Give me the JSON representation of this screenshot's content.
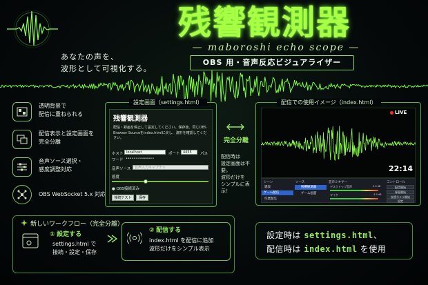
{
  "title": "残響観測器",
  "subtitle": "— maboroshi echo scope —",
  "badge": "OBS 用・音声反応ビジュアライザー",
  "tagline": [
    "あなたの声を、",
    "波形として可視化する。"
  ],
  "features": [
    {
      "icon": "transparent-window-icon",
      "text": "透明背景で\n配信に重ねられる"
    },
    {
      "icon": "dual-screen-icon",
      "text": "配信表示と設定画面を\n完全分離"
    },
    {
      "icon": "sliders-icon",
      "text": "音声ソース選択・\n感度調整対応"
    },
    {
      "icon": "network-icon",
      "text": "OBS WebSocket 5.x 対応"
    }
  ],
  "settings_panel": {
    "tag": "設定画面（settings.html）",
    "heading": "残響観測器",
    "note": "配信・録画を停止して設定してください。保存後、同じOBS Browser Sourceをindex.htmlに戻し、波形を確認してください。",
    "host_label": "ホスト",
    "host_value": "localhost",
    "port_label": "ポート",
    "port_value": "4455",
    "password_label": "パス",
    "password_label2": "ワード",
    "password_value": "••••••••••••••",
    "audio_label": "音声ソース",
    "audio_placeholder": "音声入力キャプチャ",
    "sensitivity_label": "感度",
    "sensitivity_level": 0.35,
    "status": "● OBS接続済み",
    "test_button": "接続テスト",
    "save_button": "保存"
  },
  "separator": {
    "label": "完全分離",
    "note": [
      "配信時は",
      "設定画面は不要。",
      "波形だけを",
      "シンプルに表示！"
    ]
  },
  "live_panel": {
    "tag": "配信での使用イメージ（index.html）",
    "live": "LIVE",
    "time": "22:14",
    "obs": {
      "scenes_header": "シーン",
      "scenes": [
        "雑談",
        "ゲーム配信",
        "作業配信"
      ],
      "sources_header": "ソース",
      "sources": [
        "残響観測器",
        "ゲーム画面"
      ],
      "mixer_header": "音声ミキサー",
      "mixer": [
        "デスクトップ音声",
        "マイク"
      ],
      "mixer_db": [
        "0.0 dB",
        "-3.0 dB"
      ],
      "controls_header": "コントロール",
      "controls": [
        "配信開始",
        "録画開始",
        "仮想カメラ開始",
        "設定"
      ]
    }
  },
  "workflow": {
    "title": "新しいワークフロー（完全分離）",
    "step1_num": "①",
    "step1_title": "設定する",
    "step1_lines": [
      "settings.html で",
      "接続・設定・保存"
    ],
    "step2_num": "②",
    "step2_title": "配信する",
    "step2_lines": [
      "index.html を配信に追加",
      "波形だけをシンプル表示"
    ]
  },
  "bottom": {
    "line1_pre": "設定時は ",
    "line1_hl": "settings.html",
    "line1_post": "、",
    "line2_pre": "配信時は ",
    "line2_hl": "index.html",
    "line2_post": " を使用"
  },
  "colors": {
    "accent": "#7dff3a",
    "background": "#04080a"
  }
}
